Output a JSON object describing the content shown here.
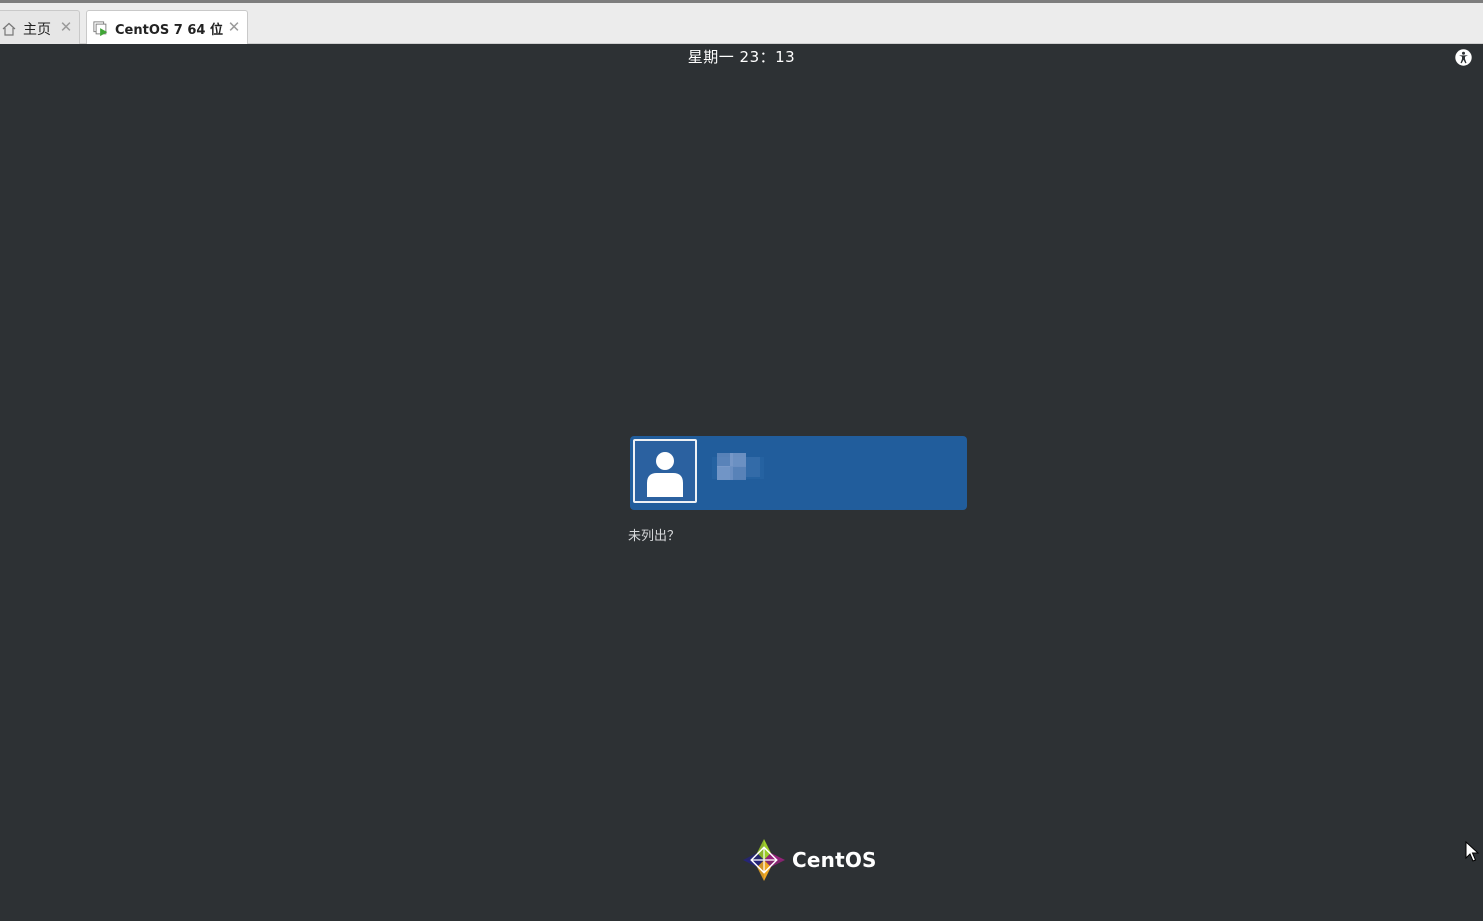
{
  "tabs": [
    {
      "label": "主页",
      "icon": "home-icon"
    },
    {
      "label": "CentOS 7 64 位",
      "icon": "vm-running-icon"
    }
  ],
  "topbar": {
    "clock": "星期一 23：13",
    "accessibility_icon": "accessibility-icon"
  },
  "login": {
    "user_icon": "user-avatar-icon",
    "username": "",
    "not_listed": "未列出？"
  },
  "branding": {
    "logo_text": "CentOS"
  },
  "colors": {
    "background": "#2d3134",
    "user_card": "#215d9c",
    "tabbar": "#ececec"
  }
}
